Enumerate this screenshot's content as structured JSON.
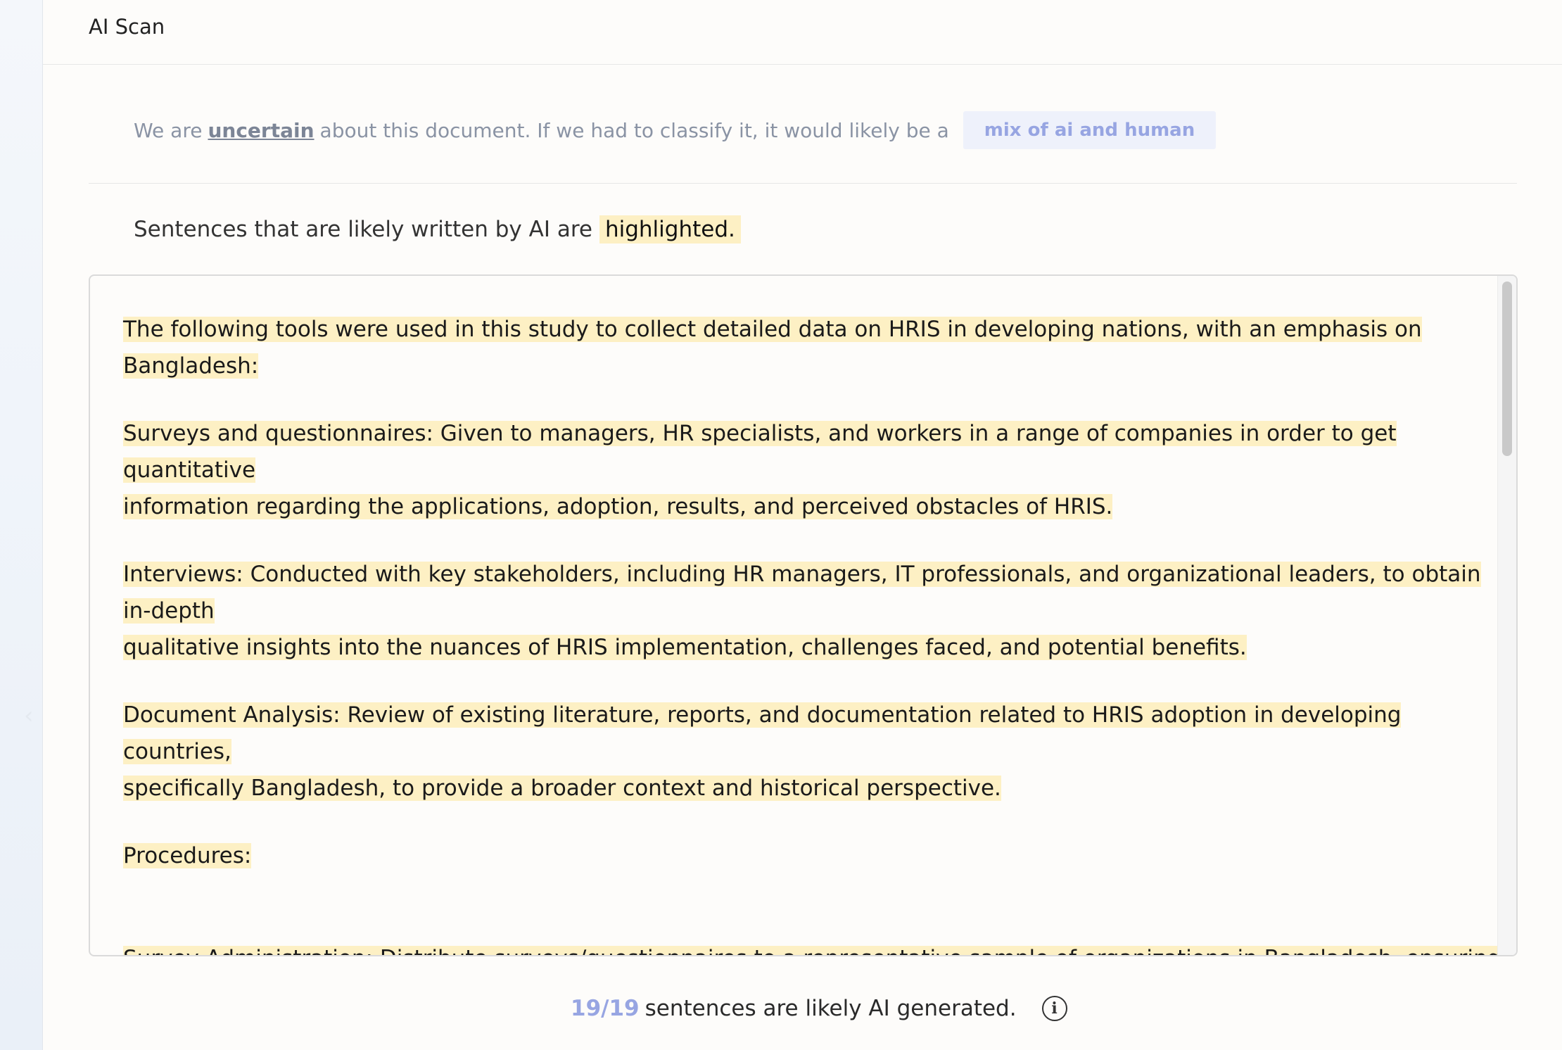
{
  "header": {
    "title": "AI Scan"
  },
  "verdict": {
    "prefix": "We are",
    "certainty": "uncertain",
    "suffix": "about this document. If we had to classify it, it would likely be a",
    "badge": "mix of ai and human"
  },
  "legend": {
    "text": "Sentences that are likely written by AI are",
    "highlight_word": "highlighted."
  },
  "document": {
    "paragraphs": [
      [
        "The following tools were used in this study to collect detailed data on HRIS in developing nations, with an emphasis on Bangladesh:"
      ],
      [
        "Surveys and questionnaires: Given to managers, HR specialists, and workers in a range of companies in order to get quantitative",
        "information regarding the applications, adoption, results, and perceived obstacles of HRIS."
      ],
      [
        "Interviews: Conducted with key stakeholders, including HR managers, IT professionals, and organizational leaders, to obtain in-depth",
        "qualitative insights into the nuances of HRIS implementation, challenges faced, and potential benefits."
      ],
      [
        "Document Analysis: Review of existing literature, reports, and documentation related to HRIS adoption in developing countries,",
        "specifically Bangladesh, to provide a broader context and historical perspective."
      ],
      [
        "Procedures:"
      ],
      [
        "Survey Administration: Distribute surveys/questionnaires to a representative sample of organizations in Bangladesh, ensuring"
      ]
    ]
  },
  "summary": {
    "count": "19/19",
    "text": "sentences are likely AI generated."
  },
  "icons": {
    "info": "info-icon",
    "rail_chevron": "chevron-left-icon"
  },
  "colors": {
    "highlight": "#fdf0c4",
    "accent": "#97a5e2",
    "badge_bg": "#eef1fb"
  }
}
